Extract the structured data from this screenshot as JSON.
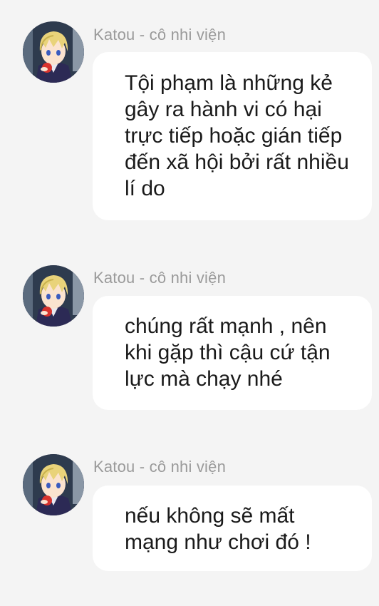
{
  "messages": [
    {
      "sender": "Katou - cô nhi viện",
      "avatar": "anime-boy-avatar",
      "text": "Tội phạm là những kẻ gây ra hành vi có hại trực tiếp hoặc gián tiếp đến xã hội bởi rất nhiều lí do"
    },
    {
      "sender": "Katou - cô nhi viện",
      "avatar": "anime-boy-avatar",
      "text": "chúng rất mạnh , nên khi gặp thì cậu cứ tận lực mà chạy nhé"
    },
    {
      "sender": "Katou - cô nhi viện",
      "avatar": "anime-boy-avatar",
      "text": "nếu không sẽ mất mạng như chơi đó !"
    }
  ]
}
